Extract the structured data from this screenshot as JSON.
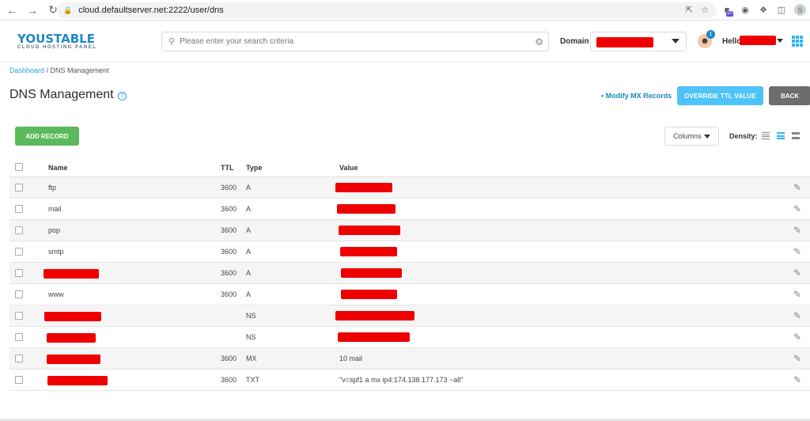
{
  "browser": {
    "url": "cloud.defaultserver.net:2222/user/dns",
    "extension_badge": "10",
    "profile_initial": "S"
  },
  "header": {
    "logo_main": "YOUSTABLE",
    "logo_sub": "CLOUD HOSTING PANEL",
    "search_placeholder": "Please enter your search criteria",
    "domain_label": "Domain",
    "notification_count": "1",
    "hello_label": "Hello,"
  },
  "breadcrumb": {
    "dashboard": "Dashboard",
    "separator": " / ",
    "current": "DNS Management"
  },
  "page": {
    "title": "DNS Management",
    "help": "?",
    "modify_mx": "• Modify MX Records",
    "override_ttl": "OVERRIDE TTL VALUE",
    "back": "BACK"
  },
  "toolbar": {
    "add_record": "ADD RECORD",
    "columns": "Columns",
    "density_label": "Density:"
  },
  "table": {
    "headers": {
      "name": "Name",
      "ttl": "TTL",
      "type": "Type",
      "value": "Value"
    },
    "rows": [
      {
        "name": "ftp",
        "ttl": "3600",
        "type": "A",
        "value": ""
      },
      {
        "name": "mail",
        "ttl": "3600",
        "type": "A",
        "value": ""
      },
      {
        "name": "pop",
        "ttl": "3600",
        "type": "A",
        "value": ""
      },
      {
        "name": "smtp",
        "ttl": "3600",
        "type": "A",
        "value": ""
      },
      {
        "name": "",
        "ttl": "3600",
        "type": "A",
        "value": ""
      },
      {
        "name": "www",
        "ttl": "3600",
        "type": "A",
        "value": ""
      },
      {
        "name": "",
        "ttl": "",
        "type": "NS",
        "value": ""
      },
      {
        "name": "",
        "ttl": "",
        "type": "NS",
        "value": ""
      },
      {
        "name": "",
        "ttl": "3600",
        "type": "MX",
        "value": "10 mail"
      },
      {
        "name": "",
        "ttl": "3600",
        "type": "TXT",
        "value": "\"v=spf1 a mx ip4:174.138.177.173 ~all\""
      }
    ]
  },
  "colors": {
    "accent": "#29b6f6",
    "add_button": "#5cb85c",
    "back_button": "#6d6d6d",
    "redaction": "#ee0000"
  }
}
